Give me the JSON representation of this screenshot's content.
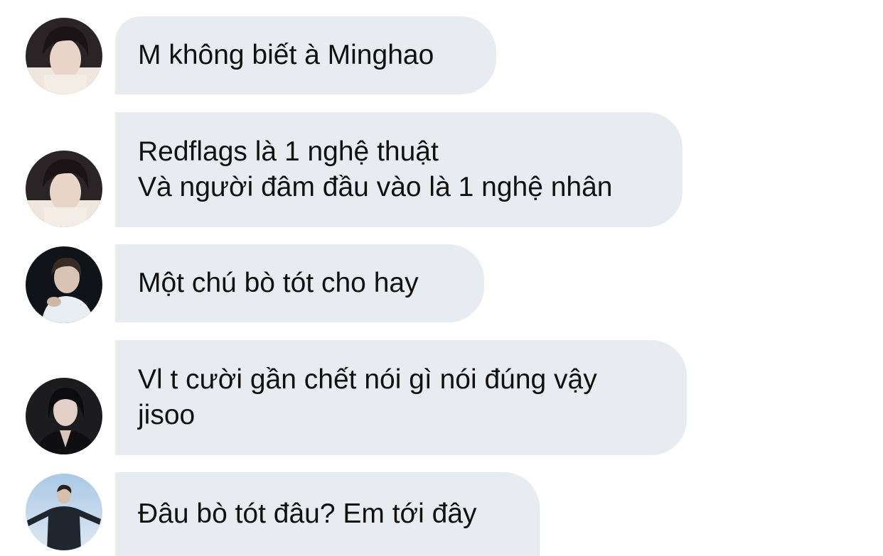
{
  "messages": [
    {
      "lines": [
        "M không biết à Minghao"
      ],
      "avatar_icon": "profile-avatar-icon"
    },
    {
      "lines": [
        "Redflags là 1 nghệ thuật",
        "Và người đâm đầu vào là 1 nghệ nhân"
      ],
      "avatar_icon": "profile-avatar-icon"
    },
    {
      "lines": [
        "Một chú bò tót cho hay"
      ],
      "avatar_icon": "profile-avatar-icon"
    },
    {
      "lines": [
        "Vl t cười gần chết nói gì nói đúng vậy",
        "jisoo"
      ],
      "avatar_icon": "profile-avatar-icon"
    },
    {
      "lines": [
        "Đâu bò tót đâu? Em tới đây"
      ],
      "avatar_icon": "profile-avatar-icon"
    }
  ],
  "colors": {
    "background": "#ffffff",
    "bubble": "#e8ebf0",
    "text": "#111111"
  }
}
